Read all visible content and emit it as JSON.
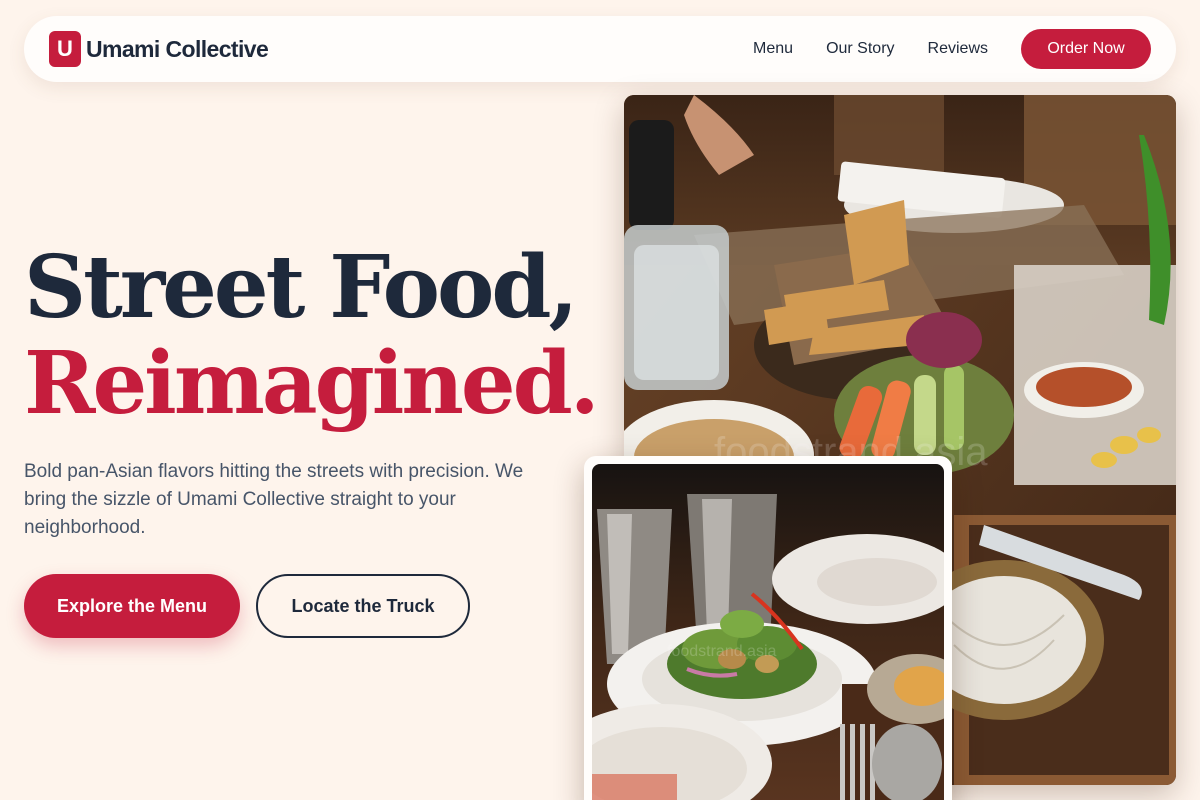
{
  "brand": {
    "mark": "U",
    "name": "Umami Collective",
    "accent_color": "#c51d3d",
    "dark_color": "#1e293b"
  },
  "nav": {
    "links": [
      "Menu",
      "Our Story",
      "Reviews"
    ],
    "cta": "Order Now"
  },
  "hero": {
    "title_line1": "Street Food,",
    "title_line2": "Reimagined.",
    "description": "Bold pan-Asian flavors hitting the streets with precision. We bring the sizzle of Umami Collective straight to your neighborhood.",
    "primary_button": "Explore the Menu",
    "secondary_button": "Locate the Truck"
  },
  "images": {
    "main_watermark": "foodstrand.asia",
    "small_watermark": "foodstrand.asia"
  }
}
